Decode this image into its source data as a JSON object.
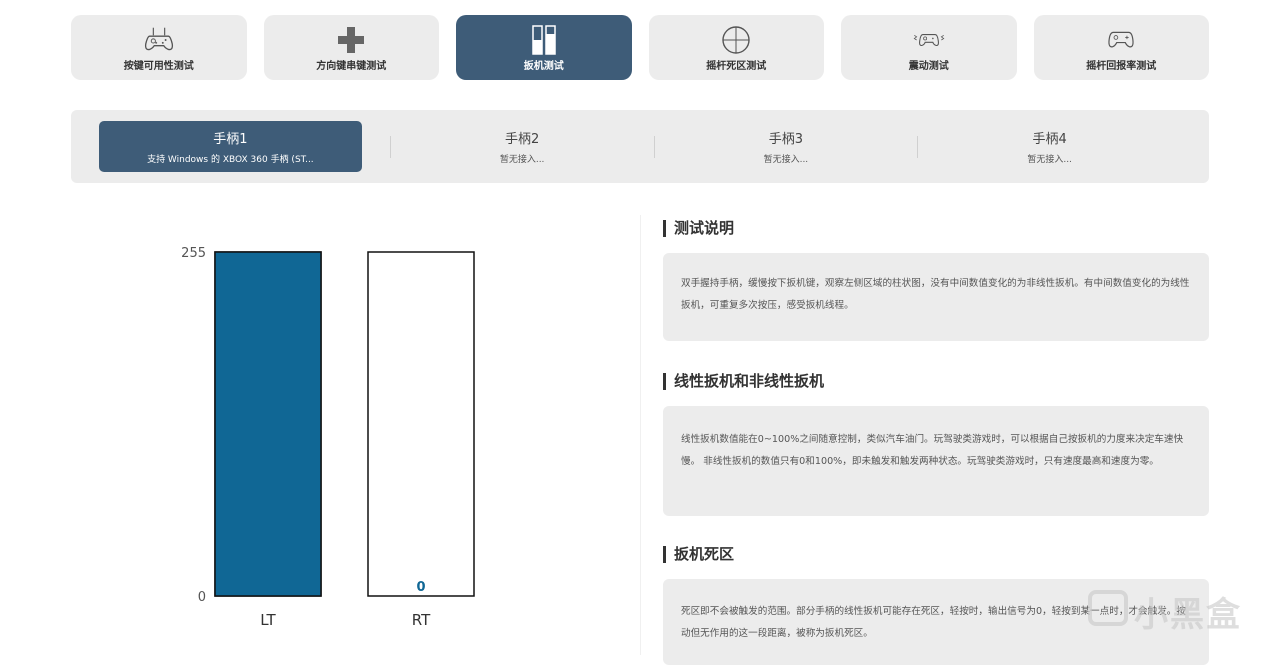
{
  "tabs": [
    {
      "label": "按键可用性测试",
      "icon": "gamepad-icon",
      "active": false
    },
    {
      "label": "方向键串键测试",
      "icon": "dpad-icon",
      "active": false
    },
    {
      "label": "扳机测试",
      "icon": "trigger-bars-icon",
      "active": true
    },
    {
      "label": "摇杆死区测试",
      "icon": "crosshair-icon",
      "active": false
    },
    {
      "label": "震动测试",
      "icon": "vibrating-gamepad-icon",
      "active": false
    },
    {
      "label": "摇杆回报率测试",
      "icon": "gamepad-outline-icon",
      "active": false
    }
  ],
  "controllers": [
    {
      "name": "手柄1",
      "status": "支持 Windows 的 XBOX 360 手柄 (ST...",
      "active": true
    },
    {
      "name": "手柄2",
      "status": "暂无接入...",
      "active": false
    },
    {
      "name": "手柄3",
      "status": "暂无接入...",
      "active": false
    },
    {
      "name": "手柄4",
      "status": "暂无接入...",
      "active": false
    }
  ],
  "colors": {
    "accent": "#3e5c78",
    "bar_fill": "#106795",
    "panel_bg": "#ececec"
  },
  "chart_data": {
    "type": "bar",
    "categories": [
      "LT",
      "RT"
    ],
    "values": [
      255,
      0
    ],
    "ylim": [
      0,
      255
    ],
    "yticks": [
      "255",
      "0"
    ],
    "data_labels": [
      "",
      "0"
    ],
    "title": "",
    "xlabel": "",
    "ylabel": ""
  },
  "sections": [
    {
      "title": "测试说明",
      "body": "双手握持手柄，缓慢按下扳机键，观察左侧区域的柱状图，没有中间数值变化的为非线性扳机。有中间数值变化的为线性扳机，可重复多次按压，感受扳机线程。"
    },
    {
      "title": "线性扳机和非线性扳机",
      "body": "线性扳机数值能在0~100%之间随意控制，类似汽车油门。玩驾驶类游戏时，可以根据自己按扳机的力度来决定车速快慢。 非线性扳机的数值只有0和100%，即未触发和触发两种状态。玩驾驶类游戏时，只有速度最高和速度为零。"
    },
    {
      "title": "扳机死区",
      "body": "死区即不会被触发的范围。部分手柄的线性扳机可能存在死区，轻按时，输出信号为0，轻按到某一点时，才会触发。按动但无作用的这一段距离，被称为扳机死区。"
    }
  ],
  "watermark": "小黑盒"
}
